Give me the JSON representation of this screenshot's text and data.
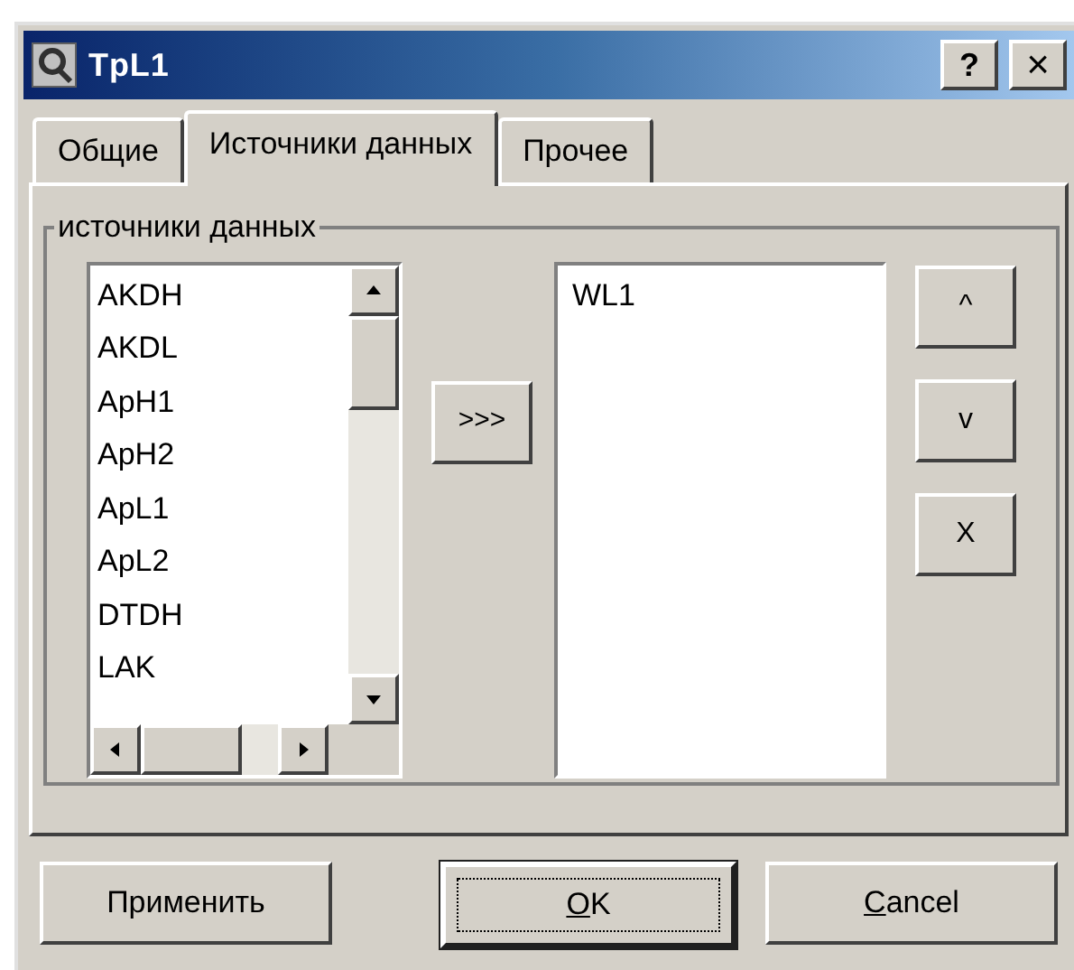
{
  "window": {
    "title": "TpL1",
    "help_button": "?",
    "close_button": "×"
  },
  "tabs": [
    {
      "label": "Общие",
      "selected": false
    },
    {
      "label": "Источники данных",
      "selected": true
    },
    {
      "label": "Прочее",
      "selected": false
    }
  ],
  "group": {
    "legend": "источники данных"
  },
  "available": {
    "items": [
      "AKDH",
      "AKDL",
      "ApH1",
      "ApH2",
      "ApL1",
      "ApL2",
      "DTDH",
      "LAK"
    ]
  },
  "add_button": ">>>",
  "selected_list": {
    "items": [
      "WL1"
    ]
  },
  "side_buttons": [
    "^",
    "v",
    "X"
  ],
  "footer_buttons": [
    {
      "rest": "Применить",
      "default": false
    },
    {
      "mnemonic": "O",
      "rest": "K",
      "default": true
    },
    {
      "mnemonic": "C",
      "rest": "ancel",
      "default": false
    }
  ]
}
